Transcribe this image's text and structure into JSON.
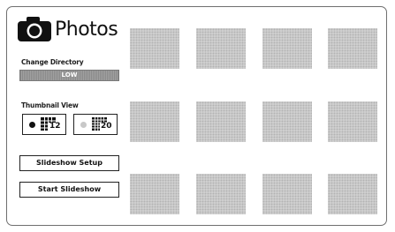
{
  "header": {
    "title": "Photos"
  },
  "directory": {
    "label": "Change Directory",
    "value": "LOW"
  },
  "thumbnail_view": {
    "label": "Thumbnail View",
    "options": [
      {
        "count": "12",
        "selected": true
      },
      {
        "count": "20",
        "selected": false
      }
    ]
  },
  "buttons": {
    "slideshow_setup": "Slideshow Setup",
    "start_slideshow": "Start Slideshow"
  },
  "colors": {
    "border": "#6f6f6f",
    "thumbnail": "#c9c9c9",
    "field": "#8b8b8b"
  },
  "thumbnails": {
    "rows": 3,
    "columns": 4
  }
}
